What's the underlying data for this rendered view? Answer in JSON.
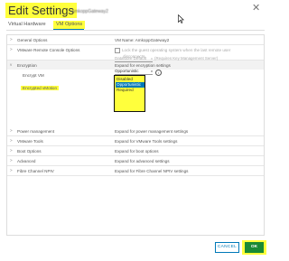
{
  "dialog": {
    "title": "Edit Settings",
    "vm_name_tag": "AmkoppGateway2",
    "close_glyph": "✕"
  },
  "tabs": [
    {
      "label": "Virtual Hardware"
    },
    {
      "label": "VM Options"
    }
  ],
  "rows": {
    "general": {
      "label": "General Options",
      "value": "VM Name: AmkoppGateway2"
    },
    "remote_console": {
      "label": "VMware Remote Console Options",
      "value": "Lock the guest operating system when the last remote user",
      "value2": "disconnects"
    },
    "encryption": {
      "label": "Encryption",
      "value": "Expand for encryption settings"
    },
    "encrypt_vm": {
      "label": "Encrypt VM",
      "value": "Datastore Default",
      "hint": "(Requires Key Management Server)"
    },
    "encrypted_vmotion": {
      "label": "Encrypted vMotion",
      "value": "Opportunistic"
    },
    "power": {
      "label": "Power management",
      "value": "Expand for power management settings"
    },
    "tools": {
      "label": "VMware Tools",
      "value": "Expand for VMware Tools settings"
    },
    "boot": {
      "label": "Boot Options",
      "value": "Expand for boot options"
    },
    "advanced": {
      "label": "Advanced",
      "value": "Expand for advanced settings"
    },
    "fibre": {
      "label": "Fibre Channel NPIV",
      "value": "Expand for Fibre Channel NPIV settings"
    }
  },
  "dropdown": {
    "options": [
      "Disabled",
      "Opportunistic",
      "Required"
    ],
    "selected": "Opportunistic"
  },
  "buttons": {
    "cancel": "CANCEL",
    "ok": "OK"
  },
  "colors": {
    "highlight": "#ffff3c",
    "accent": "#0079b8",
    "ok_green": "#1a8a34"
  },
  "icons": {
    "close": "close-icon",
    "info": "info-icon",
    "chevron": "chevron-right-icon",
    "chevron_open": "chevron-down-icon"
  }
}
